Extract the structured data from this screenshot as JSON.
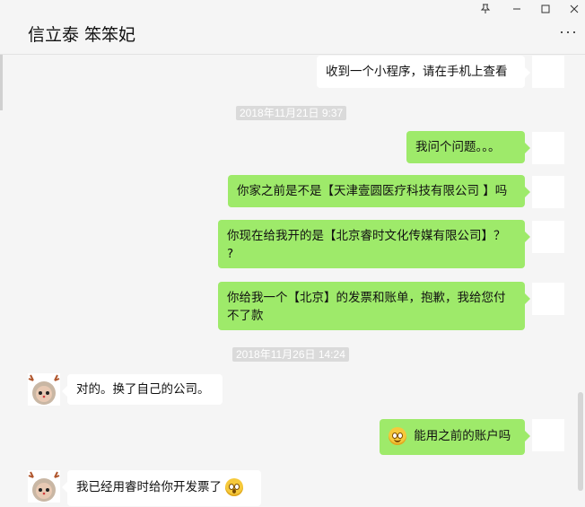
{
  "window": {
    "title": "信立泰 笨笨妃",
    "pin_icon": "pin-icon",
    "minimize_icon": "minimize-icon",
    "maximize_icon": "maximize-icon",
    "close_icon": "close-icon",
    "more_icon": "more-icon"
  },
  "messages": {
    "m0": "收到一个小程序，请在手机上查看",
    "ts1": "2018年11月21日 9:37",
    "m1": "我问个问题。。。",
    "m2": "你家之前是不是【天津壹圆医疗科技有限公司 】吗",
    "m3a": "你现在给我开的是【北京睿时文化传媒有限公司】？",
    "m3b": "?",
    "m4a": "你给我一个【北京】的发票和账单，抱歉，我给您付",
    "m4b": "不了款",
    "ts2": "2018年11月26日 14:24",
    "m5": "对的。换了自己的公司。",
    "m6": "能用之前的账户吗",
    "m7": "我已经用睿时给你开发票了"
  },
  "colors": {
    "bubble_green": "#9eea6a",
    "bubble_white": "#ffffff",
    "background": "#f5f5f5",
    "timestamp_bg": "#dadada"
  }
}
